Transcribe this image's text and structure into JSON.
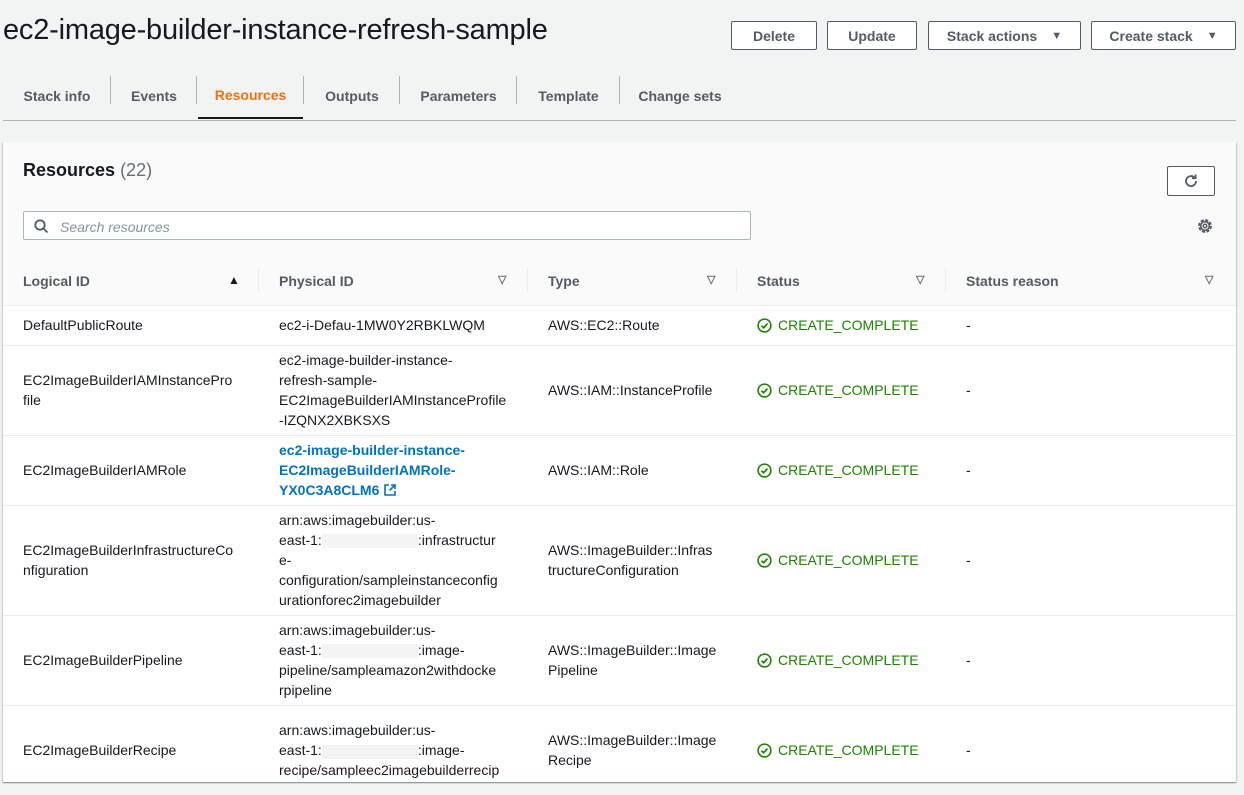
{
  "page": {
    "title": "ec2-image-builder-instance-refresh-sample"
  },
  "header_buttons": {
    "delete": "Delete",
    "update": "Update",
    "stack_actions": "Stack actions",
    "create_stack": "Create stack"
  },
  "tabs": [
    {
      "label": "Stack info",
      "active": false
    },
    {
      "label": "Events",
      "active": false
    },
    {
      "label": "Resources",
      "active": true
    },
    {
      "label": "Outputs",
      "active": false
    },
    {
      "label": "Parameters",
      "active": false
    },
    {
      "label": "Template",
      "active": false
    },
    {
      "label": "Change sets",
      "active": false
    }
  ],
  "resources": {
    "title": "Resources",
    "count": "(22)",
    "search_placeholder": "Search resources",
    "columns": [
      "Logical ID",
      "Physical ID",
      "Type",
      "Status",
      "Status reason"
    ],
    "rows": [
      {
        "logical": [
          "DefaultPublicRoute"
        ],
        "physical": [
          "ec2-i-Defau-1MW0Y2RBKLWQM"
        ],
        "type": [
          "AWS::EC2::Route"
        ],
        "status": "CREATE_COMPLETE",
        "reason": "-"
      },
      {
        "logical": [
          "EC2ImageBuilderIAMInstancePro",
          "file"
        ],
        "physical": [
          "ec2-image-builder-instance-",
          "refresh-sample-",
          "EC2ImageBuilderIAMInstanceProfile",
          "-IZQNX2XBKSXS"
        ],
        "type": [
          "AWS::IAM::InstanceProfile"
        ],
        "status": "CREATE_COMPLETE",
        "reason": "-"
      },
      {
        "logical": [
          "EC2ImageBuilderIAMRole"
        ],
        "physical": [
          "ec2-image-builder-instance-",
          "EC2ImageBuilderIAMRole-",
          "YX0C3A8CLM6"
        ],
        "type": [
          "AWS::IAM::Role"
        ],
        "status": "CREATE_COMPLETE",
        "reason": "-"
      },
      {
        "logical": [
          "EC2ImageBuilderInfrastructureCo",
          "nfiguration"
        ],
        "physical": [
          "arn:aws:imagebuilder:us-",
          "east-1:",
          ":infrastructur",
          "e-",
          "configuration/sampleinstanceconfig",
          "urationforec2imagebuilder"
        ],
        "type": [
          "AWS::ImageBuilder::Infras",
          "tructureConfiguration"
        ],
        "status": "CREATE_COMPLETE",
        "reason": "-"
      },
      {
        "logical": [
          "EC2ImageBuilderPipeline"
        ],
        "physical": [
          "arn:aws:imagebuilder:us-",
          "east-1:",
          ":image-",
          "pipeline/sampleamazon2withdocke",
          "rpipeline"
        ],
        "type": [
          "AWS::ImageBuilder::Image",
          "Pipeline"
        ],
        "status": "CREATE_COMPLETE",
        "reason": "-"
      },
      {
        "logical": [
          "EC2ImageBuilderRecipe"
        ],
        "physical": [
          "arn:aws:imagebuilder:us-",
          "east-1:",
          ":image-",
          "recipe/sampleec2imagebuilderrecip"
        ],
        "type": [
          "AWS::ImageBuilder::Image",
          "Recipe"
        ],
        "status": "CREATE_COMPLETE",
        "reason": "-"
      }
    ]
  }
}
